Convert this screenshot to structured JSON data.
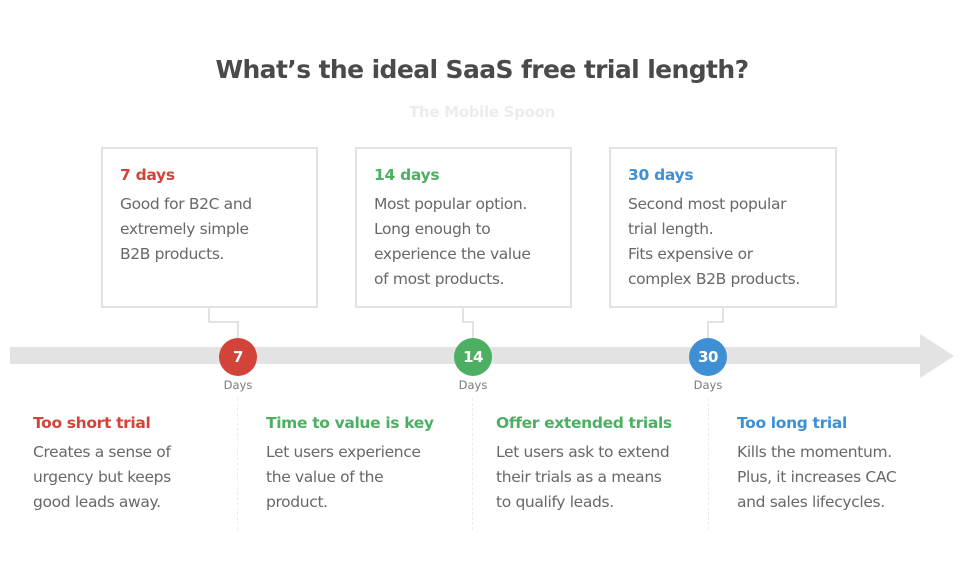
{
  "header": {
    "title": "What’s the ideal SaaS free trial length?",
    "watermark": "The Mobile Spoon"
  },
  "colors": {
    "red": "#d2443a",
    "green": "#4caf62",
    "blue": "#3f8fd4",
    "timeline": "#e3e3e3",
    "box_border": "#e2e2e2",
    "body_text": "#686868",
    "title_text": "#4a4a4a"
  },
  "boxes": [
    {
      "title": "7 days",
      "color": "red",
      "text": "Good for B2C and\nextremely simple\nB2B products."
    },
    {
      "title": "14 days",
      "color": "green",
      "text": "Most popular option.\nLong enough to\nexperience the value\nof most products."
    },
    {
      "title": "30 days",
      "color": "blue",
      "text": "Second most popular\ntrial length.\nFits expensive or\ncomplex B2B products."
    }
  ],
  "timeline": {
    "milestones": [
      {
        "value": "7",
        "unit": "Days",
        "color": "red"
      },
      {
        "value": "14",
        "unit": "Days",
        "color": "green"
      },
      {
        "value": "30",
        "unit": "Days",
        "color": "blue"
      }
    ]
  },
  "notes": [
    {
      "title": "Too short trial",
      "color": "red",
      "text": "Creates a sense of\nurgency but keeps\ngood leads away."
    },
    {
      "title": "Time to value is key",
      "color": "green",
      "text": "Let users experience\nthe value of the\nproduct."
    },
    {
      "title": "Offer extended trials",
      "color": "green",
      "text": "Let users ask to extend\ntheir trials as a means\nto qualify leads."
    },
    {
      "title": "Too long trial",
      "color": "blue",
      "text": "Kills the momentum.\nPlus, it increases CAC\nand sales lifecycles."
    }
  ]
}
